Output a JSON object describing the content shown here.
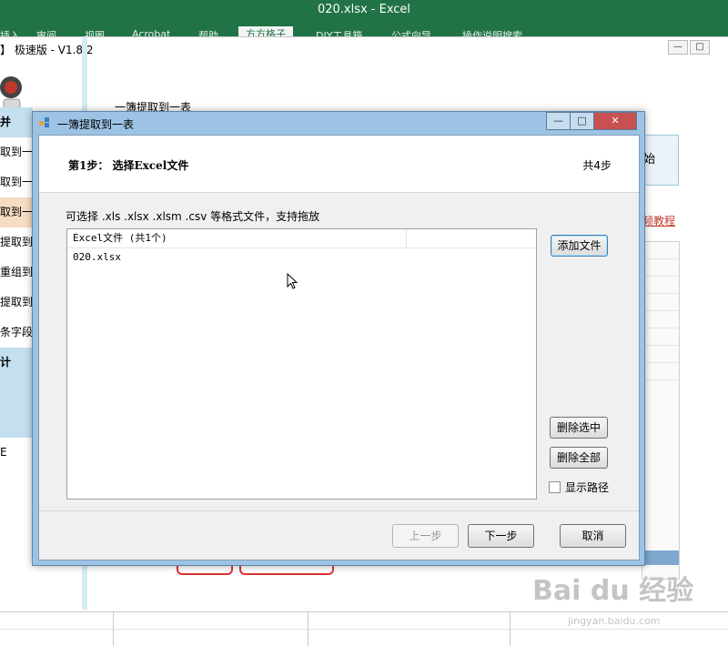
{
  "excel": {
    "title": "020.xlsx  -  Excel",
    "tabs": [
      "插入",
      "审阅",
      "视图",
      "Acrobat",
      "帮助",
      "方方格子",
      "DIY工具箱",
      "公式向导",
      "操作说明搜索"
    ]
  },
  "tool": {
    "title_fragment": "】 极速版 - V1.8.2",
    "heading_fragment": "一簿提取到一表",
    "sidebar": [
      "并",
      "取到一簿",
      "取到一表",
      "取到一表",
      "提取到一",
      "重组到一",
      "提取到一",
      "条字段",
      "计",
      "",
      "",
      "E"
    ],
    "big_button_fragment": "始",
    "link_fragment": "频教程"
  },
  "dialog": {
    "title": "一簿提取到一表",
    "step_title": "第1步： 选择Excel文件",
    "step_count": "共4步",
    "hint": "可选择 .xls  .xlsx  .xlsm .csv 等格式文件，支持拖放",
    "list": {
      "column_header": "Excel文件 (共1个)",
      "rows": [
        "020.xlsx"
      ]
    },
    "buttons": {
      "add": "添加文件",
      "delete_selected": "删除选中",
      "delete_all": "删除全部",
      "prev": "上一步",
      "next": "下一步",
      "cancel": "取消"
    },
    "checkbox_label": "显示路径",
    "controls": {
      "min": "—",
      "max": "□",
      "close": "✕"
    }
  },
  "watermark": {
    "main": "Bai du 经验",
    "sub": "jingyan.baidu.com"
  },
  "colors": {
    "excel_green": "#217346",
    "dialog_frame": "#9cc3e4",
    "close_red": "#c75050"
  }
}
